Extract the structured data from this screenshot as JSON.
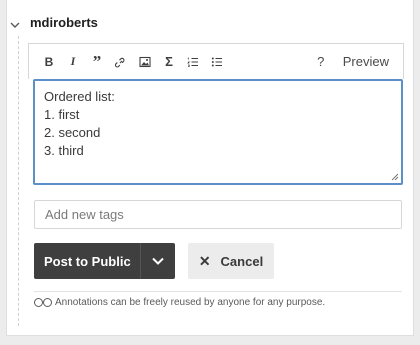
{
  "header": {
    "username": "mdiroberts"
  },
  "toolbar": {
    "bold_label": "B",
    "italic_label": "I",
    "quote_label": "”",
    "math_label": "Σ",
    "help_label": "?",
    "preview_label": "Preview"
  },
  "editor": {
    "lines": [
      "Ordered list:",
      "1. first",
      "2. second",
      "3. third"
    ]
  },
  "tags": {
    "placeholder": "Add new tags"
  },
  "actions": {
    "post_label": "Post to Public",
    "cancel_label": "Cancel",
    "cancel_icon": "✕"
  },
  "license": {
    "text": "Annotations can be freely reused by anyone for any purpose."
  }
}
